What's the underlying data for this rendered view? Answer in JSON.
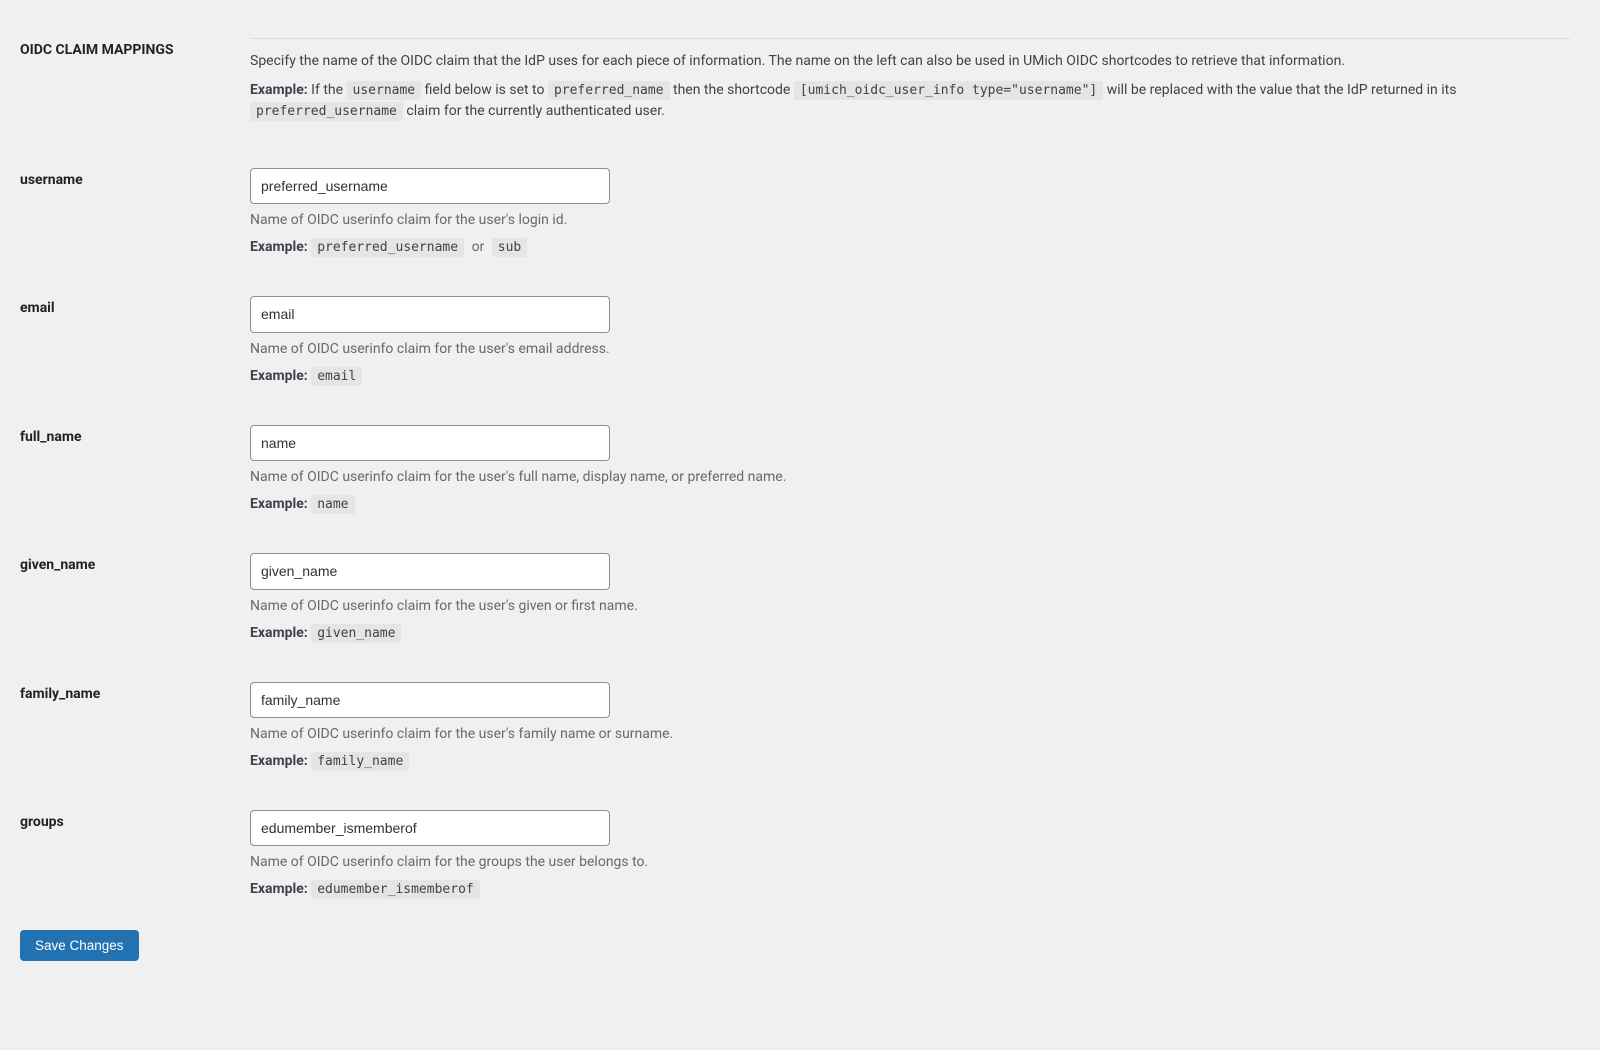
{
  "section": {
    "title": "OIDC CLAIM MAPPINGS",
    "intro_p1": "Specify the name of the OIDC claim that the IdP uses for each piece of information. The name on the left can also be used in UMich OIDC shortcodes to retrieve that information.",
    "example_label": "Example:",
    "intro_ex_pre": " If the ",
    "intro_code1": "username",
    "intro_ex_mid": " field below is set to ",
    "intro_code2": "preferred_name",
    "intro_ex_post_shortcode_pre": " then the shortcode ",
    "intro_code3": "[umich_oidc_user_info type=\"username\"]",
    "intro_ex_tail1": " will be replaced with the value that the IdP returned in its ",
    "intro_code4": "preferred_username",
    "intro_ex_tail2": " claim for the currently authenticated user."
  },
  "fields": {
    "username": {
      "label": "username",
      "value": "preferred_username",
      "help": "Name of OIDC userinfo claim for the user's login id.",
      "example_code1": "preferred_username",
      "example_or": "or",
      "example_code2": "sub"
    },
    "email": {
      "label": "email",
      "value": "email",
      "help": "Name of OIDC userinfo claim for the user's email address.",
      "example_code": "email"
    },
    "full_name": {
      "label": "full_name",
      "value": "name",
      "help": "Name of OIDC userinfo claim for the user's full name, display name, or preferred name.",
      "example_code": "name"
    },
    "given_name": {
      "label": "given_name",
      "value": "given_name",
      "help": "Name of OIDC userinfo claim for the user's given or first name.",
      "example_code": "given_name"
    },
    "family_name": {
      "label": "family_name",
      "value": "family_name",
      "help": "Name of OIDC userinfo claim for the user's family name or surname.",
      "example_code": "family_name"
    },
    "groups": {
      "label": "groups",
      "value": "edumember_ismemberof",
      "help": "Name of OIDC userinfo claim for the groups the user belongs to.",
      "example_code": "edumember_ismemberof"
    }
  },
  "save_button": "Save Changes"
}
